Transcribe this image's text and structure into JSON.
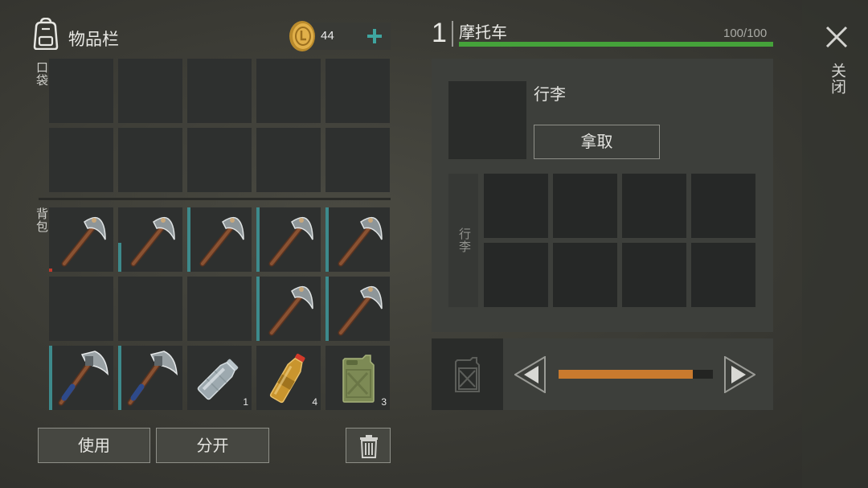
{
  "inventory": {
    "title": "物品栏",
    "coins": "44",
    "pocket_label": "口袋",
    "backpack_label": "背包",
    "items": [
      {
        "icon": "pickaxe-icon",
        "durability": 0.05,
        "count": ""
      },
      {
        "icon": "pickaxe-icon",
        "durability": 0.45,
        "count": ""
      },
      {
        "icon": "pickaxe-icon",
        "durability": 1.0,
        "count": ""
      },
      {
        "icon": "pickaxe-icon",
        "durability": 1.0,
        "count": ""
      },
      {
        "icon": "pickaxe-icon",
        "durability": 1.0,
        "count": ""
      },
      {
        "icon": "pickaxe-icon",
        "durability": 1.0,
        "count": ""
      },
      {
        "icon": "pickaxe-icon",
        "durability": 1.0,
        "count": ""
      },
      {
        "icon": "hatchet-icon",
        "durability": 1.0,
        "count": ""
      },
      {
        "icon": "hatchet-icon",
        "durability": 1.0,
        "count": ""
      },
      {
        "icon": "water-bottle-icon",
        "count": "1"
      },
      {
        "icon": "soda-bottle-icon",
        "count": "4"
      },
      {
        "icon": "jerrycan-icon",
        "count": "3"
      }
    ],
    "use_label": "使用",
    "split_label": "分开"
  },
  "vehicle": {
    "level": "1",
    "name": "摩托车",
    "health": "100/100",
    "health_fraction": 1.0,
    "luggage_title": "行李",
    "take_label": "拿取",
    "luggage_label": "行李",
    "fuel_fraction": 0.87
  },
  "close_label": "关闭",
  "colors": {
    "health": "#45a23a",
    "fuel": "#c97a2e",
    "durability": "#3d8a8c",
    "accent_plus": "#3fa5a0"
  }
}
